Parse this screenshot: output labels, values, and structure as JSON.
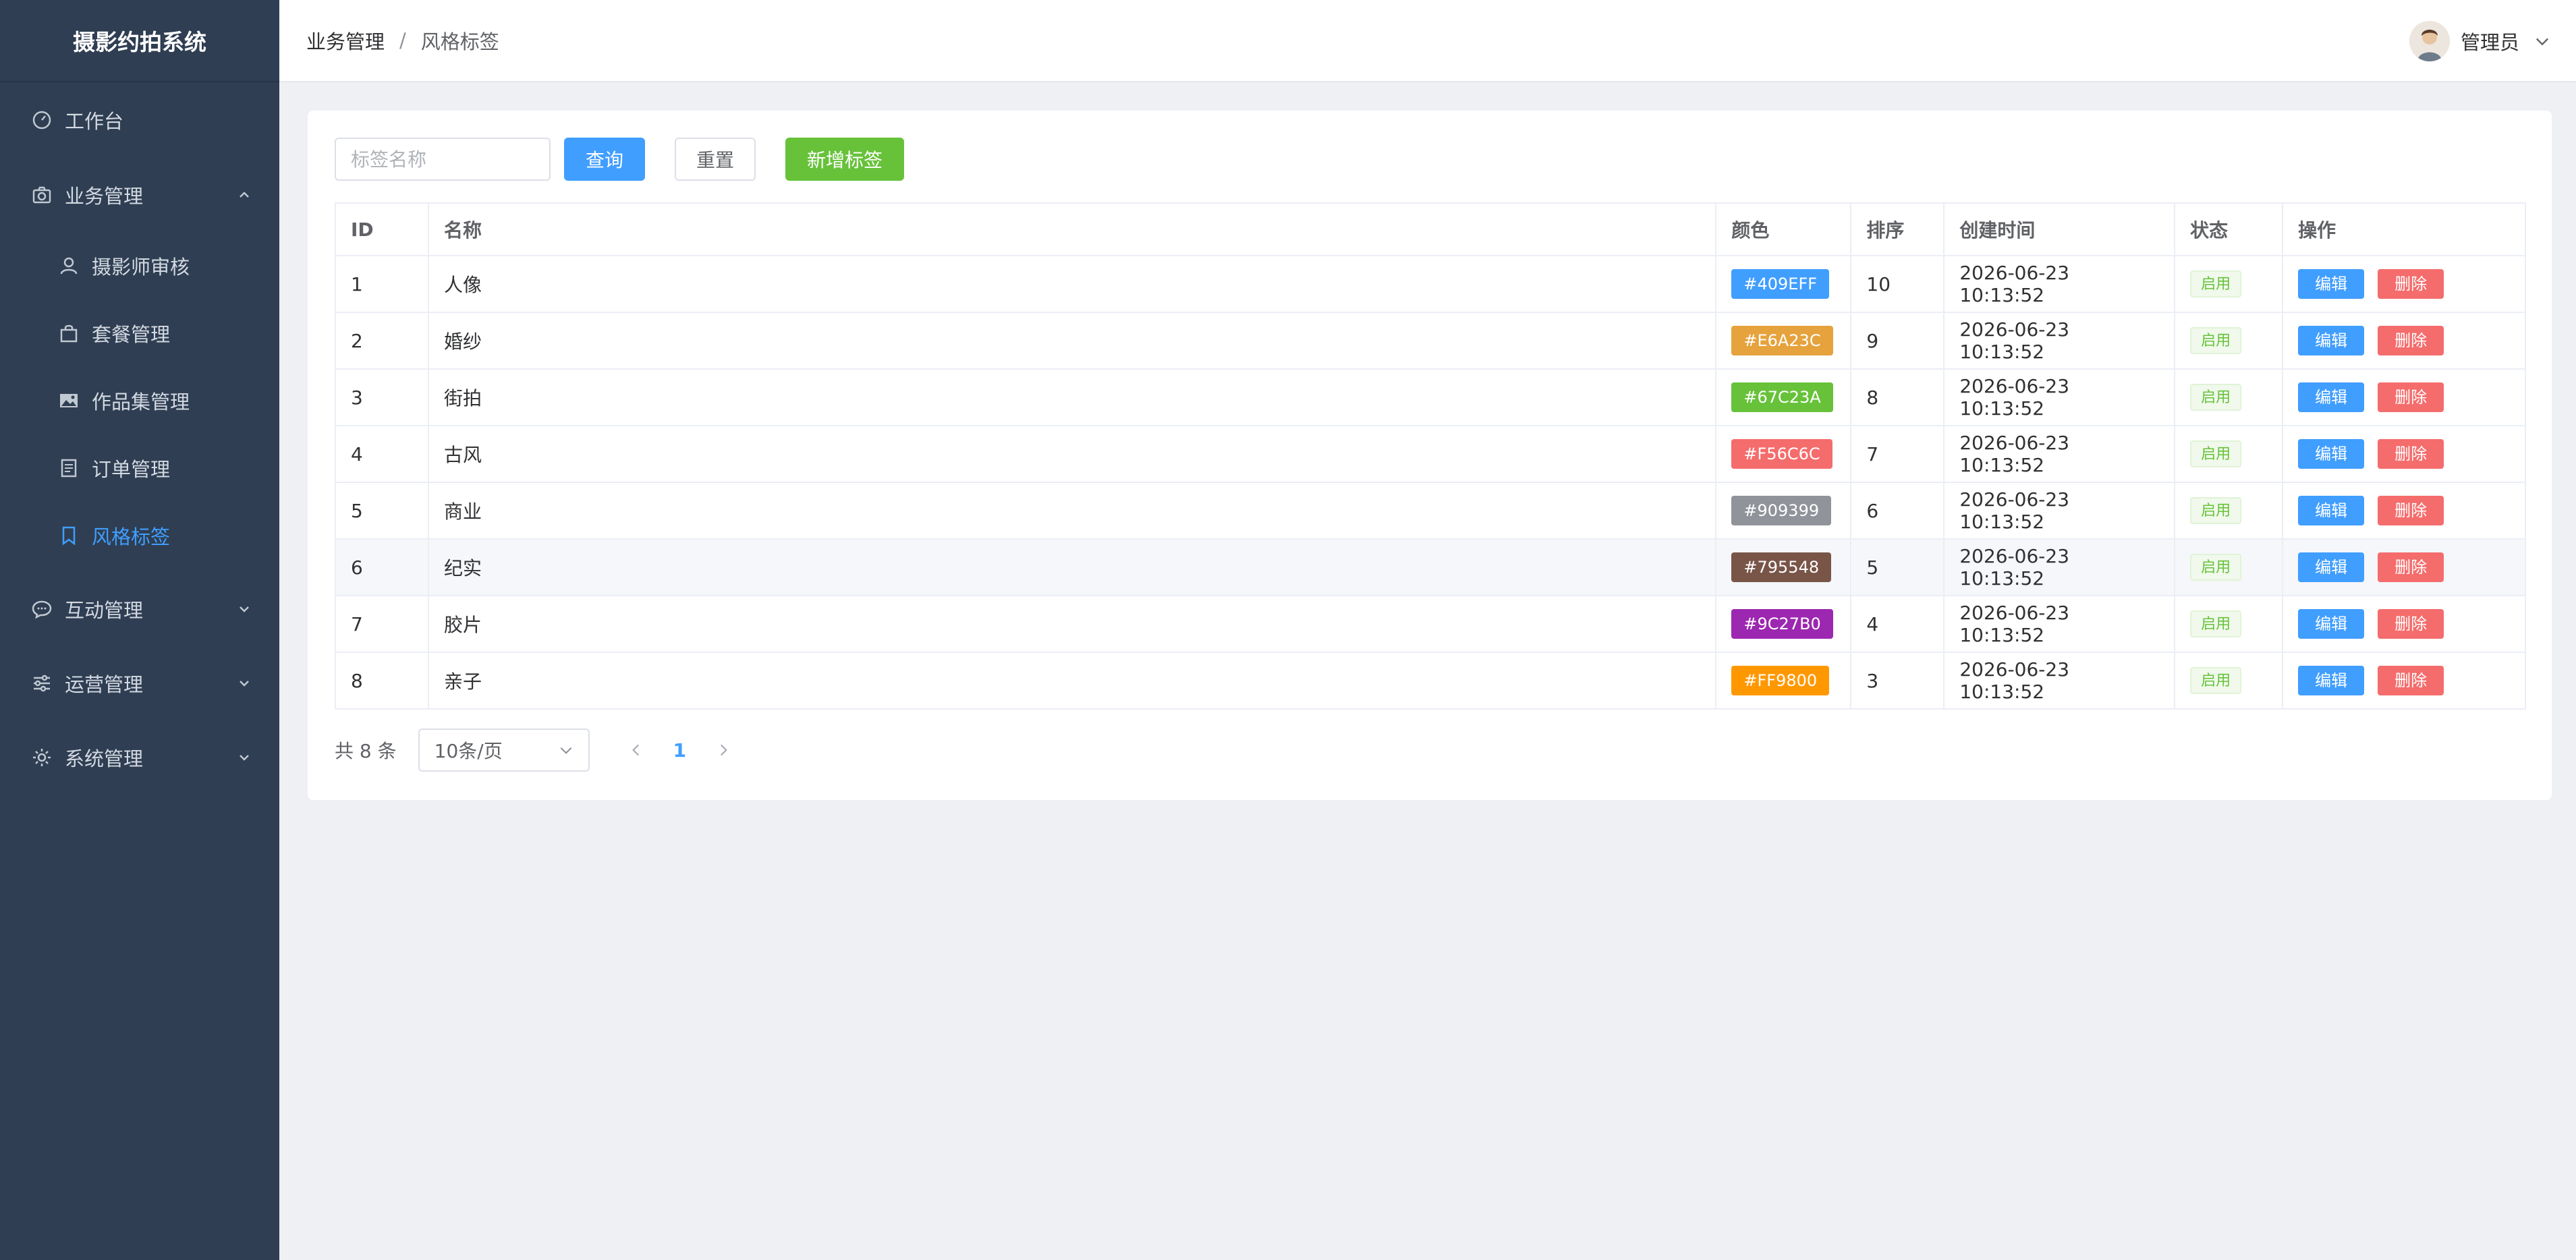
{
  "app": {
    "title": "摄影约拍系统"
  },
  "sidebar": {
    "items": [
      {
        "label": "工作台",
        "icon": "dashboard-icon"
      },
      {
        "label": "业务管理",
        "icon": "camera-icon",
        "expanded": true
      },
      {
        "label": "摄影师审核",
        "icon": "user-icon",
        "sub": true
      },
      {
        "label": "套餐管理",
        "icon": "shopping-bag-icon",
        "sub": true
      },
      {
        "label": "作品集管理",
        "icon": "picture-icon",
        "sub": true
      },
      {
        "label": "订单管理",
        "icon": "document-icon",
        "sub": true
      },
      {
        "label": "风格标签",
        "icon": "bookmark-icon",
        "sub": true,
        "active": true
      },
      {
        "label": "互动管理",
        "icon": "chat-icon",
        "expanded": false
      },
      {
        "label": "运营管理",
        "icon": "sliders-icon",
        "expanded": false
      },
      {
        "label": "系统管理",
        "icon": "gear-icon",
        "expanded": false
      }
    ]
  },
  "header": {
    "breadcrumb": [
      "业务管理",
      "风格标签"
    ],
    "separator": "/",
    "user": "管理员"
  },
  "toolbar": {
    "search_placeholder": "标签名称",
    "search_value": "",
    "query_label": "查询",
    "reset_label": "重置",
    "add_label": "新增标签"
  },
  "table": {
    "columns": [
      "ID",
      "名称",
      "颜色",
      "排序",
      "创建时间",
      "状态",
      "操作"
    ],
    "edit_label": "编辑",
    "delete_label": "删除",
    "rows": [
      {
        "id": "1",
        "name": "人像",
        "color": "#409EFF",
        "sort": "10",
        "created": "2026-06-23 10:13:52",
        "status": "启用"
      },
      {
        "id": "2",
        "name": "婚纱",
        "color": "#E6A23C",
        "sort": "9",
        "created": "2026-06-23 10:13:52",
        "status": "启用"
      },
      {
        "id": "3",
        "name": "街拍",
        "color": "#67C23A",
        "sort": "8",
        "created": "2026-06-23 10:13:52",
        "status": "启用"
      },
      {
        "id": "4",
        "name": "古风",
        "color": "#F56C6C",
        "sort": "7",
        "created": "2026-06-23 10:13:52",
        "status": "启用"
      },
      {
        "id": "5",
        "name": "商业",
        "color": "#909399",
        "sort": "6",
        "created": "2026-06-23 10:13:52",
        "status": "启用"
      },
      {
        "id": "6",
        "name": "纪实",
        "color": "#795548",
        "sort": "5",
        "created": "2026-06-23 10:13:52",
        "status": "启用"
      },
      {
        "id": "7",
        "name": "胶片",
        "color": "#9C27B0",
        "sort": "4",
        "created": "2026-06-23 10:13:52",
        "status": "启用"
      },
      {
        "id": "8",
        "name": "亲子",
        "color": "#FF9800",
        "sort": "3",
        "created": "2026-06-23 10:13:52",
        "status": "启用"
      }
    ]
  },
  "pagination": {
    "total_text": "共 8 条",
    "page_size": "10条/页",
    "current_page": "1"
  }
}
